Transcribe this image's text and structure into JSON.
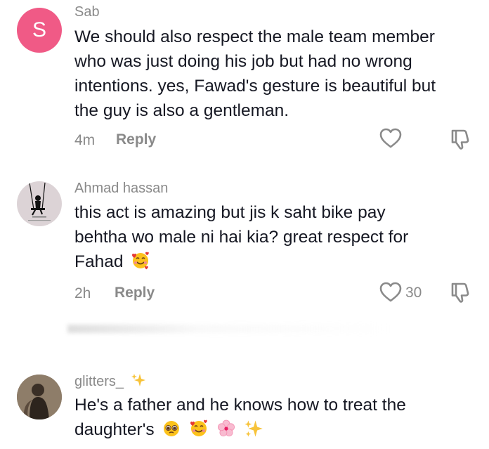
{
  "comments": [
    {
      "username": "Sab",
      "avatar_letter": "S",
      "text_lines": [
        "We should also respect the male team member",
        "who was just doing his job but had no wrong",
        "intentions. yes, Fawad's gesture is beautiful but",
        "the guy is also a gentleman."
      ],
      "time": "4m",
      "reply_label": "Reply",
      "likes": ""
    },
    {
      "username": "Ahmad hassan",
      "text_lines": [
        "this act is amazing but jis k saht bike pay",
        "behtha wo male ni hai kia? great respect for",
        "Fahad"
      ],
      "emoji_after_text": "smiling-face-with-hearts",
      "time": "2h",
      "reply_label": "Reply",
      "likes": "30"
    },
    {
      "username": "glitters_",
      "username_emoji": "sparkles",
      "text_lines": [
        "He's a father and he knows how to treat the",
        "daughter's"
      ],
      "emojis_after_text": [
        "pleading-face",
        "smiling-face-with-hearts",
        "cherry-blossom",
        "sparkles"
      ]
    }
  ],
  "colors": {
    "avatar_s": "#f05a86",
    "meta_gray": "#8a8a8a",
    "text": "#161823"
  }
}
